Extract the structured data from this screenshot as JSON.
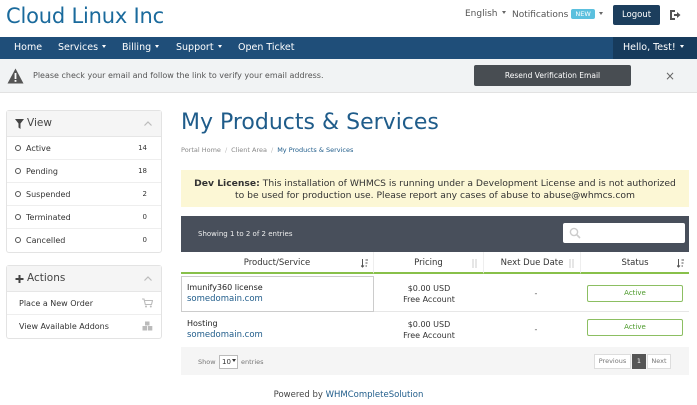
{
  "header": {
    "brand": "Cloud Linux Inc",
    "language": "English",
    "notifications": "Notifications",
    "new_badge": "NEW",
    "logout": "Logout"
  },
  "nav": {
    "home": "Home",
    "services": "Services",
    "billing": "Billing",
    "support": "Support",
    "open_ticket": "Open Ticket",
    "user": "Hello, Test!"
  },
  "alert": {
    "text": "Please check your email and follow the link to verify your email address.",
    "button": "Resend Verification Email",
    "close": "×"
  },
  "sidebar": {
    "view": {
      "title": "View",
      "items": [
        {
          "label": "Active",
          "count": "14"
        },
        {
          "label": "Pending",
          "count": "18"
        },
        {
          "label": "Suspended",
          "count": "2"
        },
        {
          "label": "Terminated",
          "count": "0"
        },
        {
          "label": "Cancelled",
          "count": "0"
        }
      ]
    },
    "actions": {
      "title": "Actions",
      "items": [
        {
          "label": "Place a New Order"
        },
        {
          "label": "View Available Addons"
        }
      ]
    }
  },
  "main": {
    "title": "My Products & Services",
    "breadcrumb": [
      "Portal Home",
      "Client Area",
      "My Products & Services"
    ],
    "dev_license_line1_bold": "Dev License:",
    "dev_license_line1": " This installation of WHMCS is running under a Development License and is not authorized",
    "dev_license_line2": "to be used for production use. Please report any cases of abuse to abuse@whmcs.com",
    "showing": "Showing 1 to 2 of 2 entries",
    "columns": [
      "Product/Service",
      "Pricing",
      "Next Due Date",
      "Status"
    ],
    "rows": [
      {
        "product": "Imunify360 license",
        "domain": "somedomain.com",
        "price": "$0.00 USD",
        "cycle": "Free Account",
        "due": "-",
        "status": "Active"
      },
      {
        "product": "Hosting",
        "domain": "somedomain.com",
        "price": "$0.00 USD",
        "cycle": "Free Account",
        "due": "-",
        "status": "Active"
      }
    ],
    "footer": {
      "show": "Show",
      "page_size": "10",
      "entries": "entries",
      "previous": "Previous",
      "page": "1",
      "next": "Next"
    }
  },
  "powered": {
    "prefix": "Powered by ",
    "link": "WHMCompleteSolution"
  },
  "colors": {
    "brand": "#1a6a9c",
    "navbar": "#1f4e79",
    "active_green": "#4c9a2a"
  }
}
